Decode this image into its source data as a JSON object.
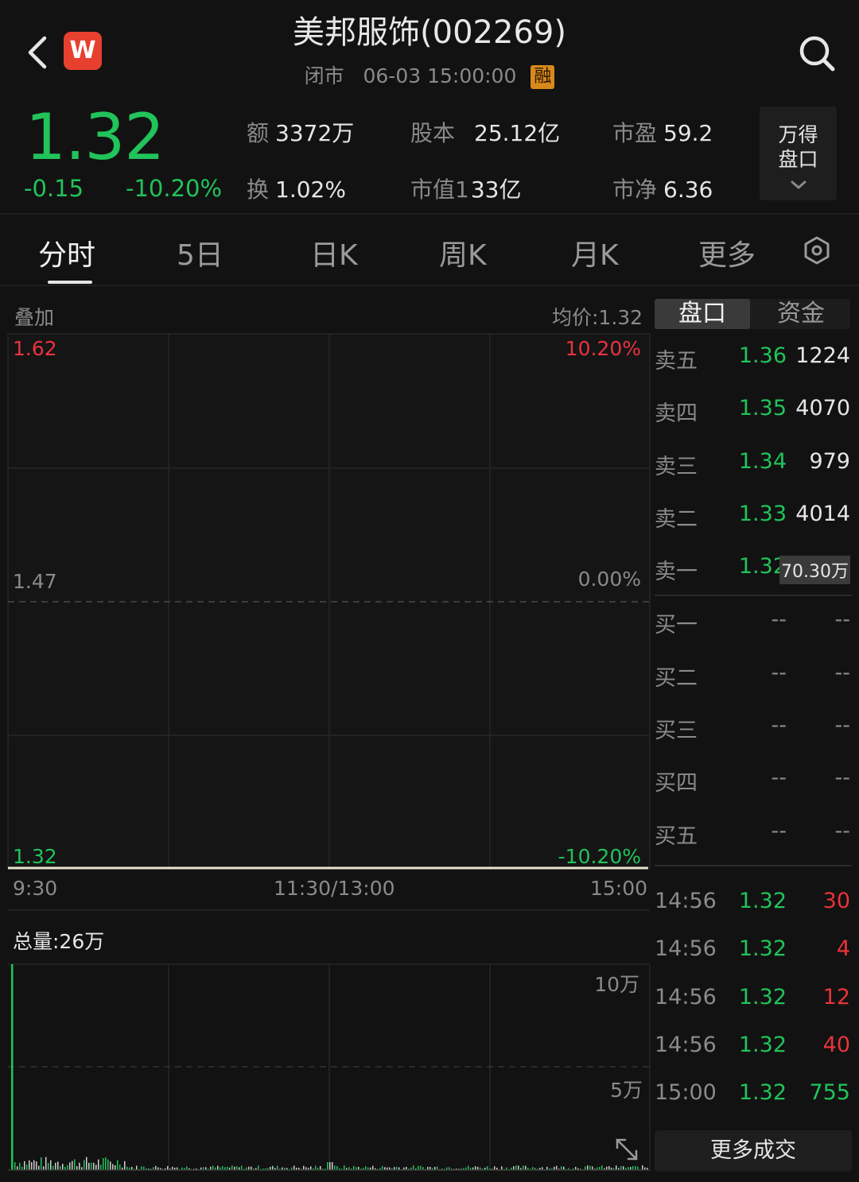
{
  "header": {
    "title": "美邦服饰(002269)",
    "status": "闭市",
    "datetime": "06-03 15:00:00",
    "badge": "融",
    "logo_letter": "W"
  },
  "quote": {
    "price": "1.32",
    "change": "-0.15",
    "change_pct": "-10.20%",
    "stats": [
      {
        "label": "额",
        "value": "3372万"
      },
      {
        "label": "股本",
        "value": "25.12亿"
      },
      {
        "label": "市盈",
        "value": "59.2"
      },
      {
        "label": "换",
        "value": "1.02%"
      },
      {
        "label": "市值1",
        "value": "33亿"
      },
      {
        "label": "市净",
        "value": "6.36"
      }
    ],
    "wande_line1": "万得",
    "wande_line2": "盘口"
  },
  "tabs": [
    "分时",
    "5日",
    "日K",
    "周K",
    "月K",
    "更多"
  ],
  "chart": {
    "overlay_label": "叠加",
    "avg_price": "均价:1.32",
    "y_top": "1.62",
    "y_mid": "1.47",
    "y_bottom": "1.32",
    "pct_top": "10.20%",
    "pct_mid": "0.00%",
    "pct_bottom": "-10.20%",
    "x_labels": [
      "9:30",
      "11:30/13:00",
      "15:00"
    ],
    "total_volume": "总量:26万",
    "vol_ticks": [
      "10万",
      "5万"
    ],
    "colors": {
      "up": "#e8333b",
      "down": "#21c35a",
      "price_line": "#e8e4d0"
    }
  },
  "order_book": {
    "tabs": [
      "盘口",
      "资金"
    ],
    "asks": [
      {
        "name": "卖五",
        "price": "1.36",
        "volume": "1224"
      },
      {
        "name": "卖四",
        "price": "1.35",
        "volume": "4070"
      },
      {
        "name": "卖三",
        "price": "1.34",
        "volume": "979"
      },
      {
        "name": "卖二",
        "price": "1.33",
        "volume": "4014"
      },
      {
        "name": "卖一",
        "price": "1.32",
        "volume": "70.30万"
      }
    ],
    "bids": [
      {
        "name": "买一",
        "price": "--",
        "volume": "--"
      },
      {
        "name": "买二",
        "price": "--",
        "volume": "--"
      },
      {
        "name": "买三",
        "price": "--",
        "volume": "--"
      },
      {
        "name": "买四",
        "price": "--",
        "volume": "--"
      },
      {
        "name": "买五",
        "price": "--",
        "volume": "--"
      }
    ]
  },
  "trades": [
    {
      "time": "14:56",
      "price": "1.32",
      "volume": "30"
    },
    {
      "time": "14:56",
      "price": "1.32",
      "volume": "4"
    },
    {
      "time": "14:56",
      "price": "1.32",
      "volume": "12"
    },
    {
      "time": "14:56",
      "price": "1.32",
      "volume": "40"
    },
    {
      "time": "15:00",
      "price": "1.32",
      "volume": "755"
    }
  ],
  "more_trades": "更多成交"
}
